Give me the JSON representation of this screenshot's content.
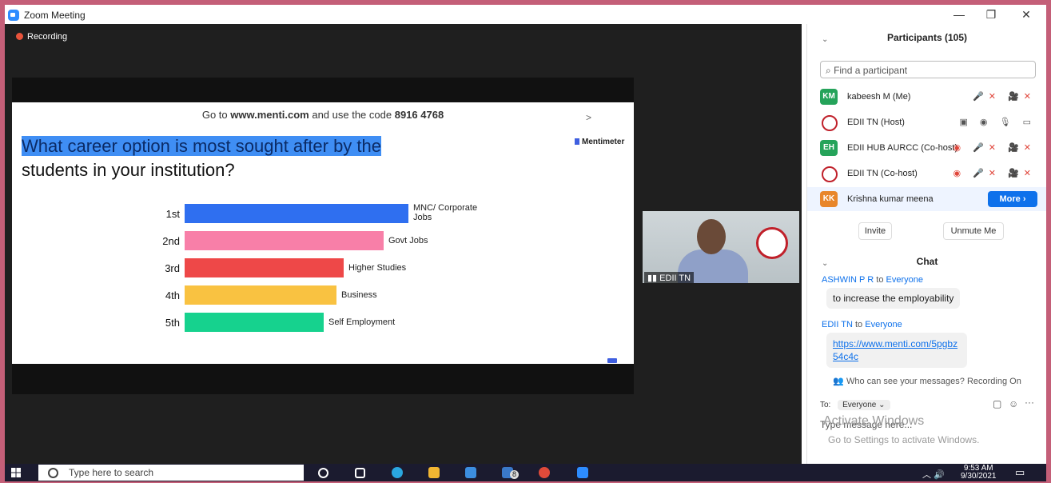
{
  "window": {
    "title": "Zoom Meeting",
    "minimize": "—",
    "restore": "❐",
    "close": "✕"
  },
  "stage": {
    "recording": "Recording"
  },
  "slide": {
    "instruction_pre": "Go to ",
    "instruction_site": "www.menti.com",
    "instruction_mid": " and use the code ",
    "instruction_code": "8916 4768",
    "question_line1": "What career option is most sought after by the",
    "question_line2": "students in your institution?",
    "brand": "Mentimeter"
  },
  "chart_data": {
    "type": "bar",
    "orientation": "horizontal",
    "categories": [
      "1st",
      "2nd",
      "3rd",
      "4th",
      "5th"
    ],
    "labels": [
      "MNC/ Corporate Jobs",
      "Govt Jobs",
      "Higher Studies",
      "Business",
      "Self Employment"
    ],
    "label_lines": [
      [
        "MNC/ Corporate",
        "Jobs"
      ],
      [
        "Govt Jobs"
      ],
      [
        "Higher Studies"
      ],
      [
        "Business"
      ],
      [
        "Self Employment"
      ]
    ],
    "values": [
      100,
      89,
      71,
      68,
      62
    ],
    "colors": [
      "#2f6ff0",
      "#f87fa8",
      "#ee4848",
      "#f9c241",
      "#16d28e"
    ]
  },
  "video": {
    "name": "EDII TN"
  },
  "participants": {
    "title": "Participants (105)",
    "search_placeholder": "Find a participant",
    "list": [
      {
        "initials": "KM",
        "name": "kabeesh M (Me)",
        "color": "#25a35a",
        "status": "🎤✕ 🎥✕"
      },
      {
        "initials": "",
        "name": "EDII TN (Host)",
        "color": "#ffffff",
        "status": "▣ ◉ 🎙 ▭"
      },
      {
        "initials": "EH",
        "name": "EDII HUB AURCC (Co-host)",
        "color": "#25a35a",
        "status": "◉ 🎤✕ 🎥✕"
      },
      {
        "initials": "",
        "name": "EDII TN (Co-host)",
        "color": "#ffffff",
        "status": "◉ 🎤✕ 🎥✕"
      },
      {
        "initials": "KK",
        "name": "Krishna kumar meena",
        "color": "#e8862a",
        "status": ""
      }
    ],
    "more": "More ›",
    "invite": "Invite",
    "unmute": "Unmute Me"
  },
  "chat": {
    "title": "Chat",
    "messages": [
      {
        "from": "ASHWIN P R",
        "to": "Everyone",
        "text": "to increase the employability"
      },
      {
        "from": "EDII TN",
        "to": "Everyone",
        "text": "https://www.menti.com/5pgbz54c4c"
      }
    ],
    "to_word": "to",
    "notice": "Who can see your messages? Recording On",
    "to_label": "To:",
    "recipient": "Everyone ⌄",
    "placeholder": "Type message here...",
    "activate_line1": "Activate Windows",
    "activate_line2": "Go to Settings to activate Windows."
  },
  "taskbar": {
    "search": "Type here to search",
    "time": "9:53 AM",
    "date": "9/30/2021",
    "badge": "8"
  }
}
